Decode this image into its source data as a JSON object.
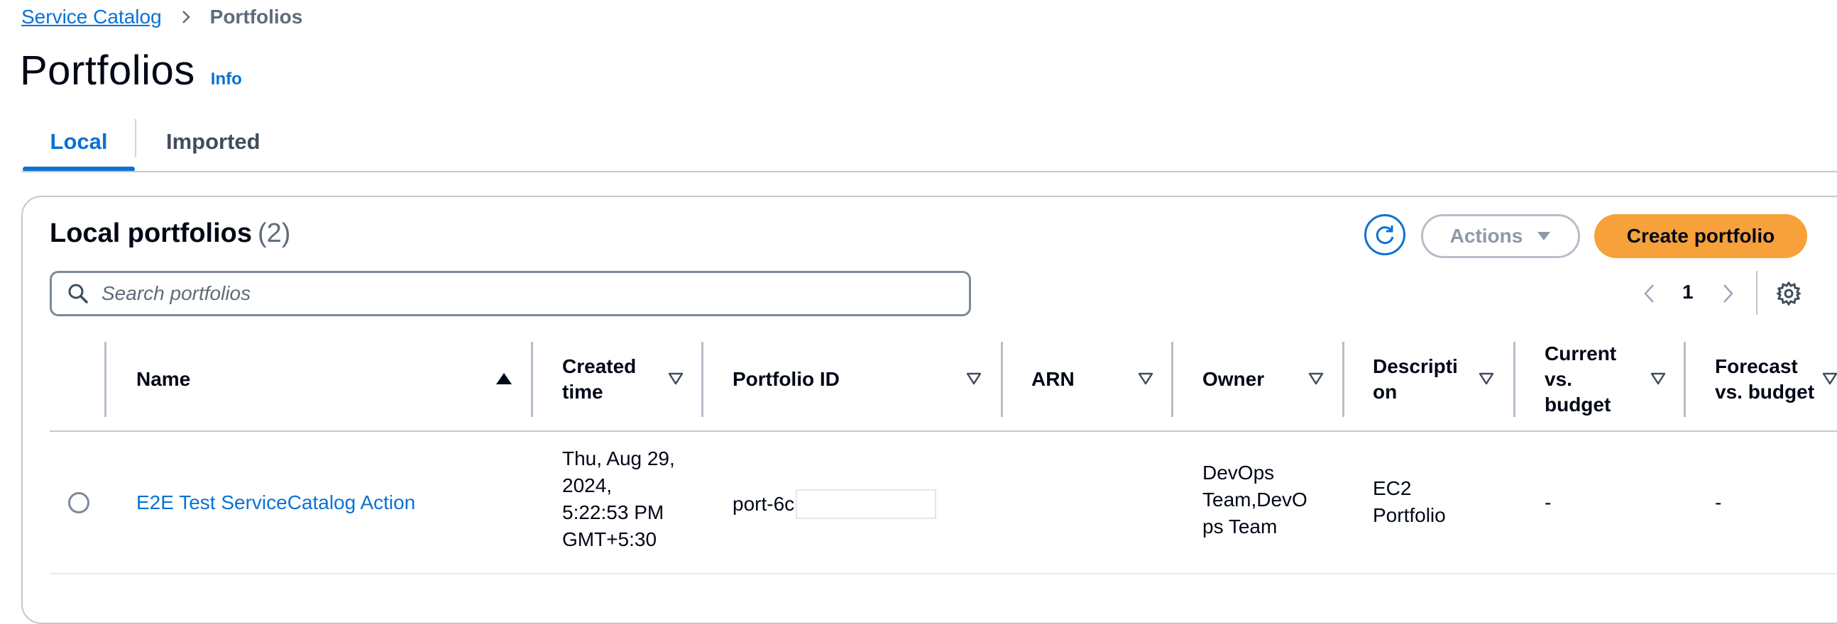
{
  "breadcrumb": {
    "root": "Service Catalog",
    "current": "Portfolios"
  },
  "page": {
    "title": "Portfolios",
    "info": "Info"
  },
  "tabs": [
    {
      "label": "Local",
      "active": true
    },
    {
      "label": "Imported",
      "active": false
    }
  ],
  "container": {
    "title": "Local portfolios",
    "count": "(2)",
    "actions_label": "Actions",
    "create_label": "Create portfolio"
  },
  "search": {
    "placeholder": "Search portfolios"
  },
  "pagination": {
    "current_page": "1"
  },
  "table": {
    "headers": [
      {
        "lines": [
          "Name"
        ]
      },
      {
        "lines": [
          "Created",
          "time"
        ]
      },
      {
        "lines": [
          "Portfolio ID"
        ]
      },
      {
        "lines": [
          "ARN"
        ]
      },
      {
        "lines": [
          "Owner"
        ]
      },
      {
        "lines": [
          "Descripti",
          "on"
        ]
      },
      {
        "lines": [
          "Current",
          "vs.",
          "budget"
        ]
      },
      {
        "lines": [
          "Forecast",
          "vs. budget"
        ]
      }
    ],
    "rows": [
      {
        "name": "E2E Test ServiceCatalog Action",
        "created": [
          "Thu, Aug 29,",
          "2024,",
          "5:22:53 PM",
          "GMT+5:30"
        ],
        "portfolio_id": "port-6c",
        "arn": "",
        "owner": [
          "DevOps",
          "Team,DevO",
          "ps Team"
        ],
        "description": [
          "EC2",
          "Portfolio"
        ],
        "current_vs_budget": "-",
        "forecast_vs_budget": "-"
      }
    ]
  },
  "colors": {
    "accent": "#0972d3",
    "primary_button": "#f6a13a",
    "text": "#000716",
    "muted": "#5f6b7a"
  },
  "icons": [
    "chevron-right-icon",
    "refresh-icon",
    "caret-down-icon",
    "search-icon",
    "chevron-left-icon",
    "gear-icon",
    "sort-ascending-icon",
    "sort-icon"
  ]
}
